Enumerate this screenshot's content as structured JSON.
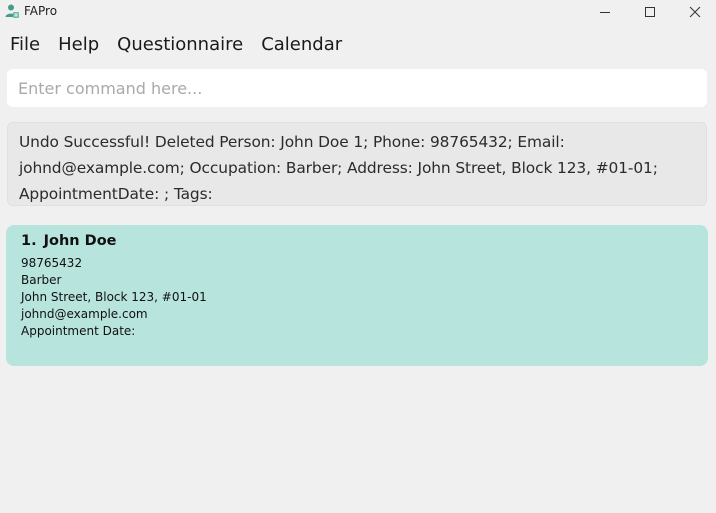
{
  "window": {
    "title": "FAPro",
    "icon": "app-person-icon",
    "accent_color": "#4a9a8c"
  },
  "menu": {
    "items": [
      {
        "label": "File"
      },
      {
        "label": "Help"
      },
      {
        "label": "Questionnaire"
      },
      {
        "label": "Calendar"
      }
    ]
  },
  "command": {
    "value": "",
    "placeholder": "Enter command here..."
  },
  "result": {
    "text": "Undo Successful! Deleted Person: John Doe 1; Phone: 98765432; Email: johnd@example.com; Occupation: Barber; Address: John Street, Block 123, #01-01; AppointmentDate: ; Tags:"
  },
  "person_list": {
    "card_color": "#b8e4de",
    "persons": [
      {
        "index": "1.",
        "name": "John Doe",
        "phone": "98765432",
        "occupation": "Barber",
        "address": "John Street, Block 123, #01-01",
        "email": "johnd@example.com",
        "appointment": "Appointment Date:"
      }
    ]
  }
}
